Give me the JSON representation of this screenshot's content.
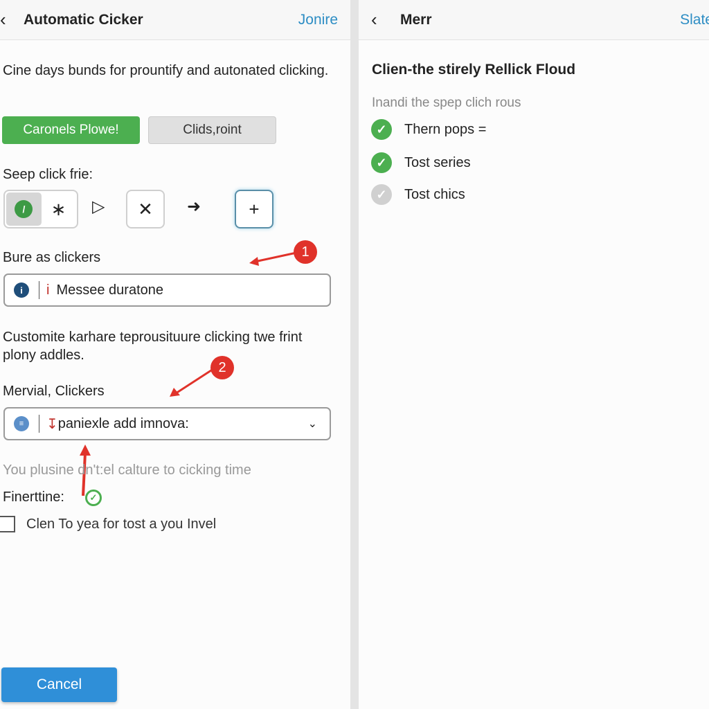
{
  "left": {
    "header": {
      "title": "Automatic Cicker",
      "action": "Jonire"
    },
    "intro": "Cine days bunds for prountify and autonated clicking.",
    "buttons": {
      "primary": "Caronels Plowe!",
      "secondary": "Clids,roint"
    },
    "step_label": "Seep click frie:",
    "section1_label": "Bure as clickers",
    "field1_value": "Messee duratone",
    "description": "Customite karhare teprousituure clicking twe frint plony addles.",
    "section2_label": "Mervial, Clickers",
    "select_value": "paniexle add imnova:",
    "hint": "You plusine dn't:el calture to cicking time",
    "finert_label": "Finerttine:",
    "checkbox_label": "Clen To yea for tost a you Invel",
    "cancel": "Cancel",
    "annotations": [
      "1",
      "2"
    ]
  },
  "right": {
    "header": {
      "title": "Merr",
      "action": "Slate"
    },
    "heading": "Clien-the stirely Rellick Floud",
    "subheading": "Inandi the spep clich rous",
    "items": [
      {
        "label": "Thern pops =",
        "status": "done"
      },
      {
        "label": "Tost series",
        "status": "done"
      },
      {
        "label": "Tost chics",
        "status": "pending"
      }
    ]
  },
  "colors": {
    "accent": "#2d8dc4",
    "primary_button": "#4caf50",
    "cancel_button": "#2f8fd8",
    "annotation": "#e0322a"
  }
}
